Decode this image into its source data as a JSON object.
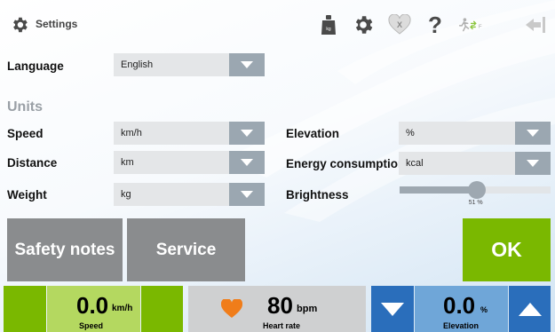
{
  "header": {
    "title": "Settings"
  },
  "language": {
    "label": "Language",
    "value": "English"
  },
  "units": {
    "heading": "Units",
    "speed": {
      "label": "Speed",
      "value": "km/h"
    },
    "distance": {
      "label": "Distance",
      "value": "km"
    },
    "weight": {
      "label": "Weight",
      "value": "kg"
    },
    "elevation": {
      "label": "Elevation",
      "value": "%"
    },
    "energy": {
      "label": "Energy consumption",
      "value": "kcal"
    },
    "brightness": {
      "label": "Brightness",
      "value_text": "51 %",
      "level_percent": 51
    }
  },
  "buttons": {
    "safety": "Safety notes",
    "service": "Service",
    "ok": "OK"
  },
  "bottom": {
    "speed": {
      "value": "0.0",
      "unit": "km/h",
      "caption": "Speed"
    },
    "heart": {
      "value": "80",
      "unit": "bpm",
      "caption": "Heart rate"
    },
    "elevation": {
      "value": "0.0",
      "unit": "%",
      "caption": "Elevation"
    }
  },
  "colors": {
    "green_dark": "#7ab800",
    "green_light": "#b4d860",
    "blue_dark": "#2a6ebb",
    "blue_light": "#6fa6d8",
    "gray_button": "#8a8c8e",
    "heart": "#f07d1a"
  },
  "icons": [
    "gear-icon",
    "weight-icon",
    "settings-gear-icon",
    "heart-x-icon",
    "help-icon",
    "runner-icon",
    "back-arrow-icon",
    "heart-icon",
    "arrow-down-icon",
    "arrow-up-icon"
  ]
}
